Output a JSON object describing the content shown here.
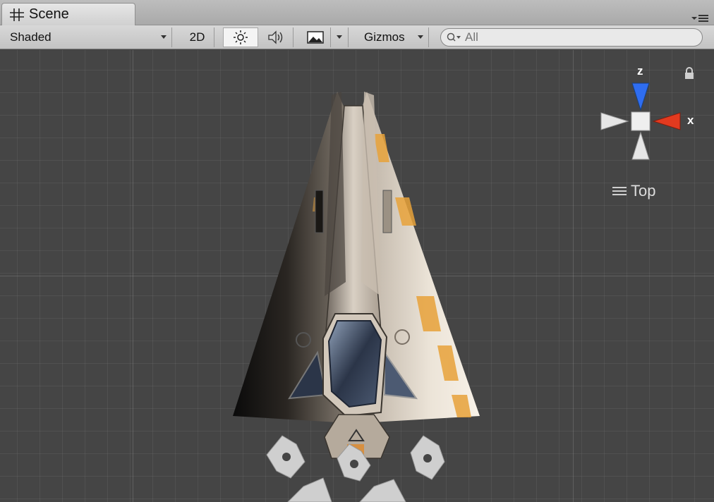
{
  "tab": {
    "title": "Scene",
    "icon": "grid-icon"
  },
  "toolbar": {
    "draw_mode": "Shaded",
    "mode_2d": "2D",
    "lighting_icon": "sun-icon",
    "audio_icon": "speaker-icon",
    "effects_icon": "image-icon",
    "gizmos": "Gizmos",
    "search_placeholder": "All"
  },
  "gizmo": {
    "axis_z": "z",
    "axis_x": "x",
    "view": "Top"
  },
  "colors": {
    "z_axis": "#2f6df0",
    "x_axis": "#e23a1f",
    "viewport": "#454545"
  }
}
